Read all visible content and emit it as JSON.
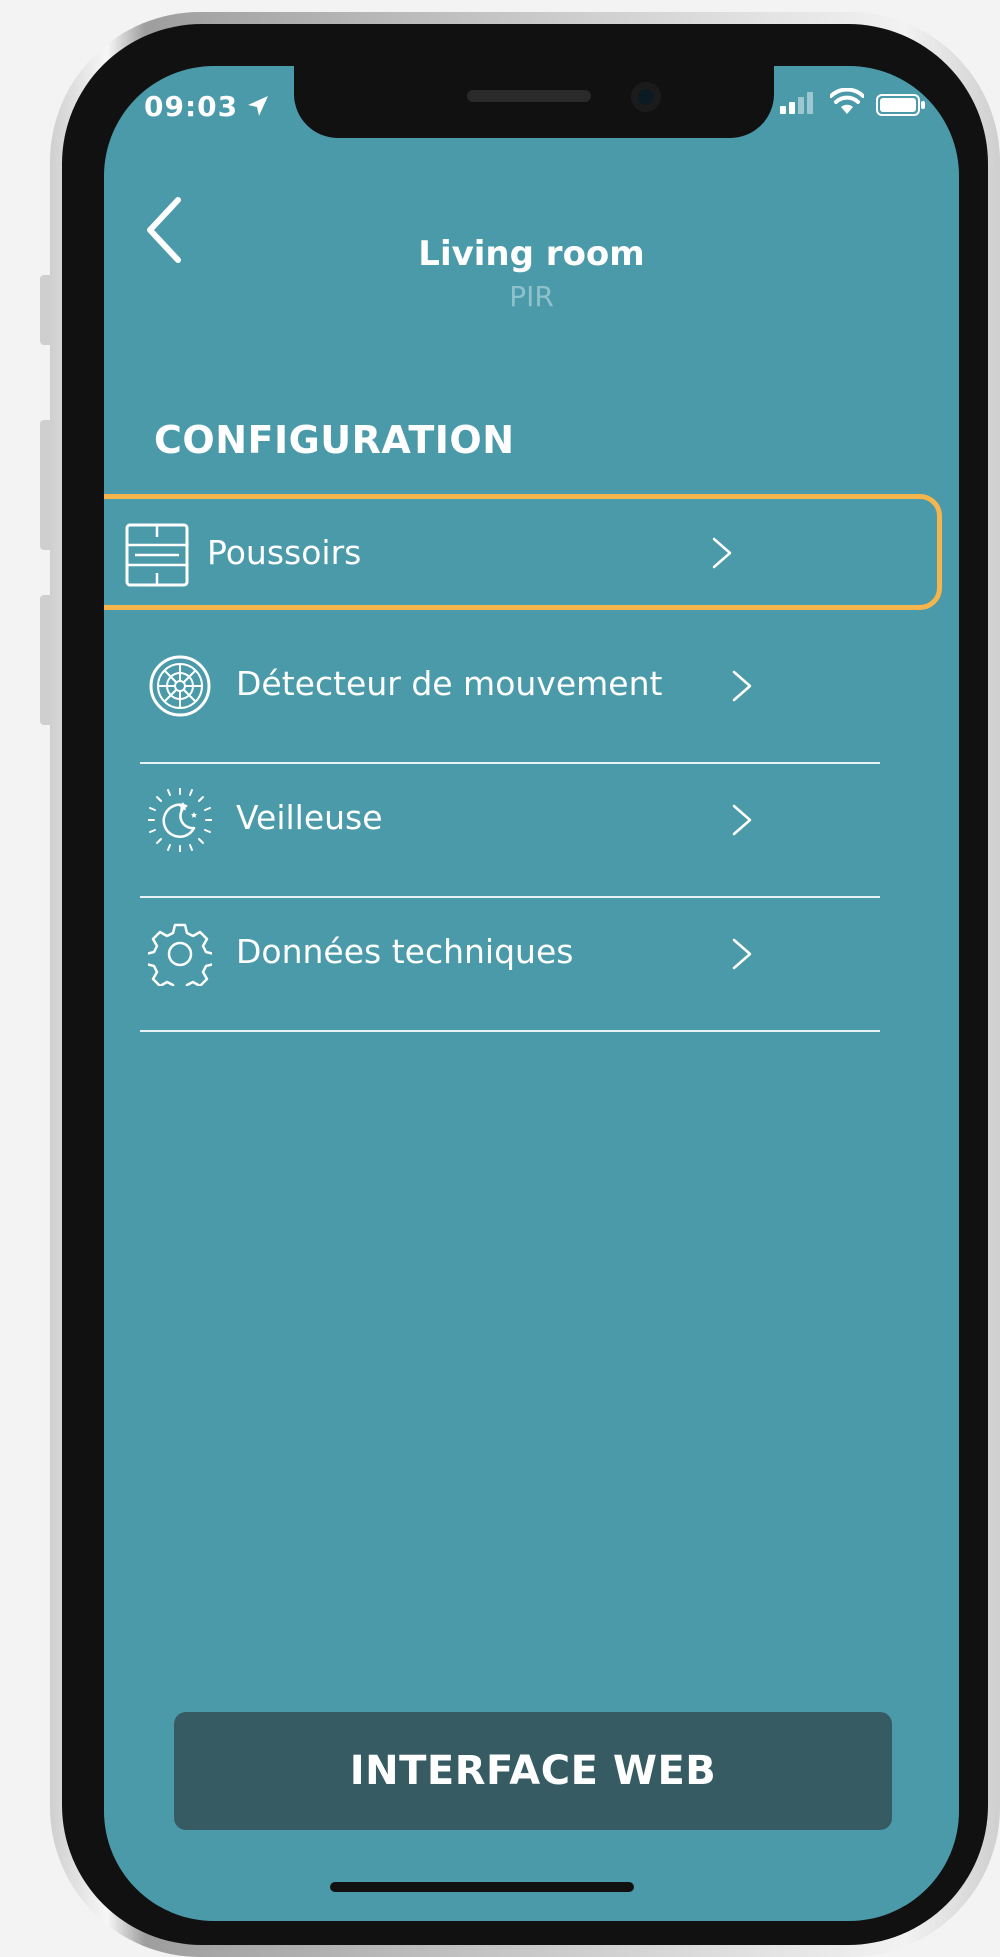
{
  "status_bar": {
    "time": "09:03"
  },
  "header": {
    "title": "Living room",
    "subtitle": "PIR"
  },
  "section_title": "CONFIGURATION",
  "menu": [
    {
      "label": "Poussoirs",
      "icon": "push-buttons-icon",
      "highlighted": true
    },
    {
      "label": "Détecteur de mouvement",
      "icon": "motion-detector-icon"
    },
    {
      "label": "Veilleuse",
      "icon": "night-light-icon"
    },
    {
      "label": "Données techniques",
      "icon": "gear-icon"
    }
  ],
  "web_button": {
    "label": "INTERFACE WEB"
  },
  "colors": {
    "background": "#4a9aaa",
    "highlight": "#f6b54c",
    "button": "#365b63"
  }
}
